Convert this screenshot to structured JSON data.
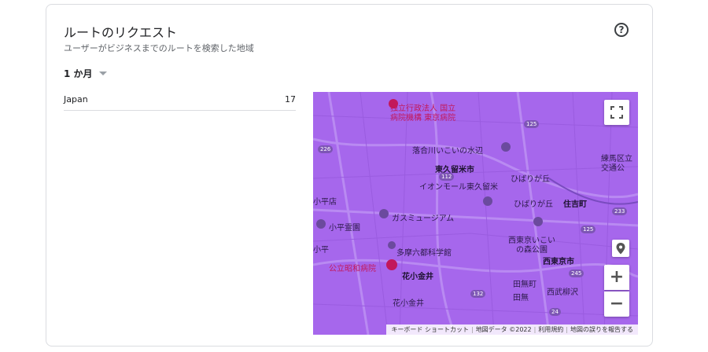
{
  "card": {
    "title": "ルートのリクエスト",
    "subtitle": "ユーザーがビジネスまでのルートを検索した地域",
    "help_glyph": "?"
  },
  "period": {
    "selected": "1 か月"
  },
  "locations": [
    {
      "name": "Japan",
      "count": "17"
    }
  ],
  "map": {
    "labels": {
      "hospital_a": "独立行政法人 国立",
      "hospital_b": "病院機構 東京病院",
      "ochiai": "落合川いこいの水辺",
      "higashikurume": "東久留米市",
      "hibarigaoka": "ひばりが丘",
      "aeon": "イオンモール東久留米",
      "hibarigaoka2": "ひばりが丘",
      "sumiyoshi": "住吉町",
      "gas_museum": "ガスミュージアム",
      "kodaira_reien": "小平霊園",
      "tama_rokuto": "多摩六都科学館",
      "nishitokyo_park1": "西東京いこい",
      "nishitokyo_park2": "の森公園",
      "nishitokyo": "西東京市",
      "showa_hospital": "公立昭和病院",
      "hanakoganei": "花小金井",
      "hanakoganei2": "花小金井",
      "tanashi_cho": "田無町",
      "tanashi": "田無",
      "seibu_yagisawa": "西武柳沢",
      "nerima1": "練馬区立",
      "nerima2": "交通公",
      "kodaira": "小平",
      "store": "小平店"
    },
    "route_badges": [
      "125",
      "226",
      "233",
      "245",
      "132",
      "112",
      "125",
      "24"
    ],
    "attribution": {
      "keyboard": "キーボード ショートカット",
      "map_data": "地図データ ©2022",
      "terms": "利用規約",
      "report": "地図の誤りを報告する"
    },
    "zoom_in": "+",
    "zoom_out": "−"
  }
}
